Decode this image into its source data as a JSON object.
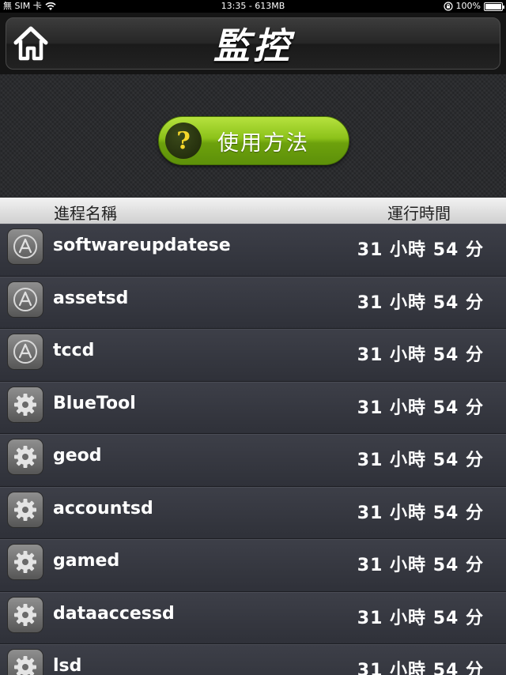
{
  "status_bar": {
    "carrier": "無 SIM 卡",
    "center": "13:35 - 613MB",
    "battery": "100%",
    "battery_level": 1.0
  },
  "header": {
    "title": "監控",
    "home_icon": "home-icon"
  },
  "help": {
    "label": "使用方法",
    "icon_glyph": "?"
  },
  "columns": {
    "name": "進程名稱",
    "time": "運行時間"
  },
  "processes": [
    {
      "name": "softwareupdatese",
      "time": "31 小時 54 分",
      "icon": "appstore-icon"
    },
    {
      "name": "assetsd",
      "time": "31 小時 54 分",
      "icon": "appstore-icon"
    },
    {
      "name": "tccd",
      "time": "31 小時 54 分",
      "icon": "appstore-icon"
    },
    {
      "name": "BlueTool",
      "time": "31 小時 54 分",
      "icon": "gear-icon"
    },
    {
      "name": "geod",
      "time": "31 小時 54 分",
      "icon": "gear-icon"
    },
    {
      "name": "accountsd",
      "time": "31 小時 54 分",
      "icon": "gear-icon"
    },
    {
      "name": "gamed",
      "time": "31 小時 54 分",
      "icon": "gear-icon"
    },
    {
      "name": "dataaccessd",
      "time": "31 小時 54 分",
      "icon": "gear-icon"
    },
    {
      "name": "lsd",
      "time": "31 小時 54 分",
      "icon": "gear-icon"
    }
  ]
}
